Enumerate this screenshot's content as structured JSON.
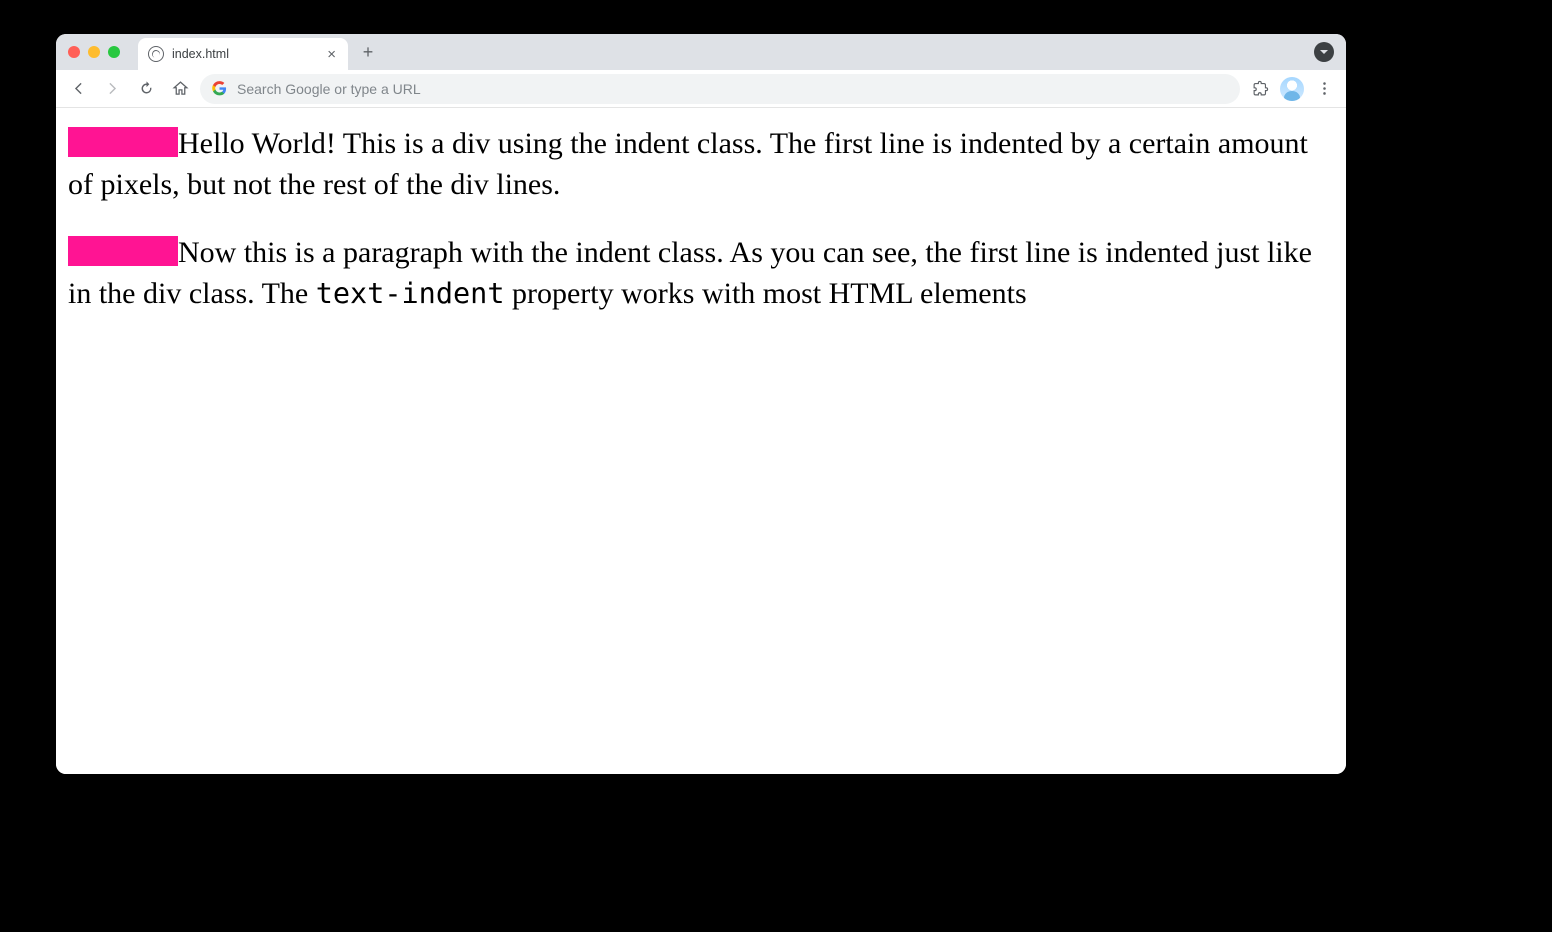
{
  "browser": {
    "tab_title": "index.html",
    "omnibox_placeholder": "Search Google or type a URL"
  },
  "content": {
    "block1": "Hello World! This is a div using the indent class. The first line is indented by a certain amount of pixels, but not the rest of the div lines.",
    "block2_a": "Now this is a paragraph with the indent class. As you can see, the first line is indented just like in the div class. The ",
    "block2_code": "text-indent",
    "block2_b": " property works with most HTML elements",
    "highlight_color": "#ff1493"
  }
}
